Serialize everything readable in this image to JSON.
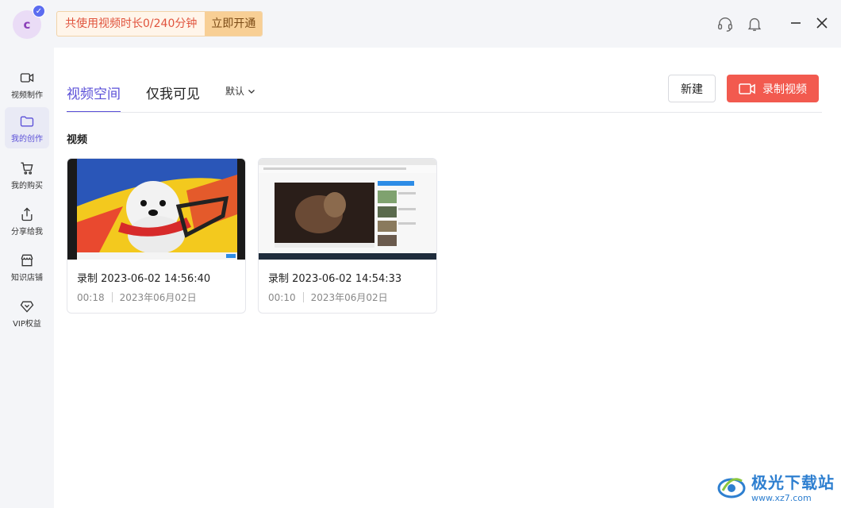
{
  "titlebar": {
    "avatar_letter": "c",
    "usage_text": "共使用视频时长0/240分钟",
    "upgrade_label": "立即开通"
  },
  "sidebar": {
    "items": [
      {
        "label": "视频制作",
        "icon": "video-camera-icon"
      },
      {
        "label": "我的创作",
        "icon": "folder-icon",
        "active": true
      },
      {
        "label": "我的购买",
        "icon": "cart-icon"
      },
      {
        "label": "分享给我",
        "icon": "share-icon"
      },
      {
        "label": "知识店铺",
        "icon": "store-icon"
      },
      {
        "label": "VIP权益",
        "icon": "diamond-icon"
      }
    ]
  },
  "main": {
    "tabs": [
      {
        "label": "视频空间",
        "active": true
      },
      {
        "label": "仅我可见",
        "active": false
      }
    ],
    "sort_label": "默认",
    "new_label": "新建",
    "record_label": "录制视频",
    "section_title": "视频",
    "videos": [
      {
        "title": "录制 2023-06-02 14:56:40",
        "duration": "00:18",
        "date": "2023年06月02日"
      },
      {
        "title": "录制 2023-06-02 14:54:33",
        "duration": "00:10",
        "date": "2023年06月02日"
      }
    ]
  },
  "watermark": {
    "main": "极光下载站",
    "sub": "www.xz7.com"
  },
  "colors": {
    "accent": "#5b50d8",
    "record": "#f25a4f",
    "usage_text": "#e0533d",
    "upgrade_bg": "#f8cf95"
  }
}
